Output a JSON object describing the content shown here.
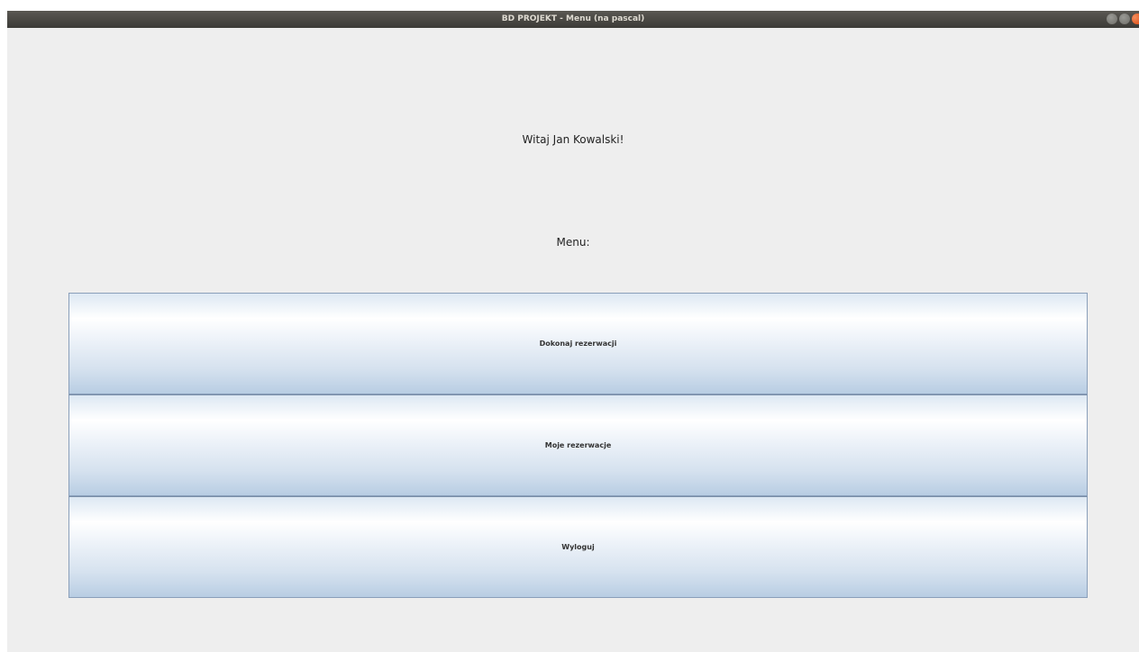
{
  "window": {
    "title": "BD PROJEKT - Menu (na pascal)"
  },
  "main": {
    "greeting": "Witaj Jan Kowalski!",
    "menu_label": "Menu:",
    "buttons": [
      {
        "label": "Dokonaj rezerwacji"
      },
      {
        "label": "Moje rezerwacje"
      },
      {
        "label": "Wyloguj"
      }
    ]
  },
  "colors": {
    "titlebar": "#3c3b37",
    "window_bg": "#eeeeee",
    "button_border": "#8a9fba",
    "button_gradient_bottom": "#b8cde3",
    "close_button": "#e0541c"
  },
  "icons": {
    "minimize": "minimize-icon",
    "maximize": "maximize-icon",
    "close": "close-icon"
  }
}
